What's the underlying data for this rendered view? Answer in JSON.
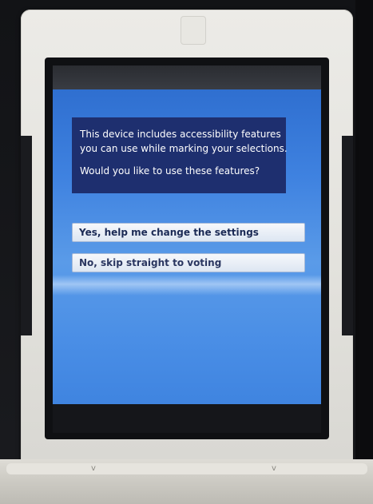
{
  "prompt": {
    "line1": "This device includes accessibility features",
    "line2": "you can use while marking your selections.",
    "question": "Would you like to use these features?"
  },
  "choices": {
    "yes_label": "Yes, help me change the settings",
    "no_label": "No, skip straight to voting"
  },
  "colors": {
    "screen_blue": "#3f82e0",
    "panel_navy": "#1e2f6f",
    "button_face": "#eef2f8",
    "bezel": "#e8e7e2"
  }
}
